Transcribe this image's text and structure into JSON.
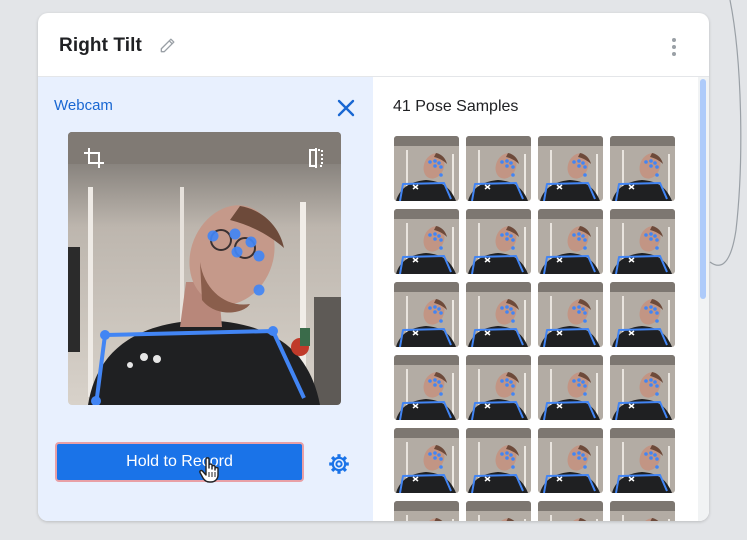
{
  "card": {
    "title": "Right Tilt"
  },
  "webcam": {
    "label": "Webcam",
    "hold_button_label": "Hold to Record"
  },
  "samples": {
    "count_label": "41 Pose Samples",
    "visible_rows": 6,
    "columns": 4
  },
  "colors": {
    "accent": "#1a73e8",
    "accent_text": "#1967d2",
    "panel_bg": "#e8f0fe",
    "keypoint": "#4285f4",
    "button_border": "#e8a0a6"
  },
  "icons": {
    "edit": "pencil-icon",
    "more": "more-vert-icon",
    "close": "close-icon",
    "crop": "crop-icon",
    "flip": "flip-icon",
    "settings": "gear-icon",
    "cursor": "hand-cursor-icon"
  }
}
